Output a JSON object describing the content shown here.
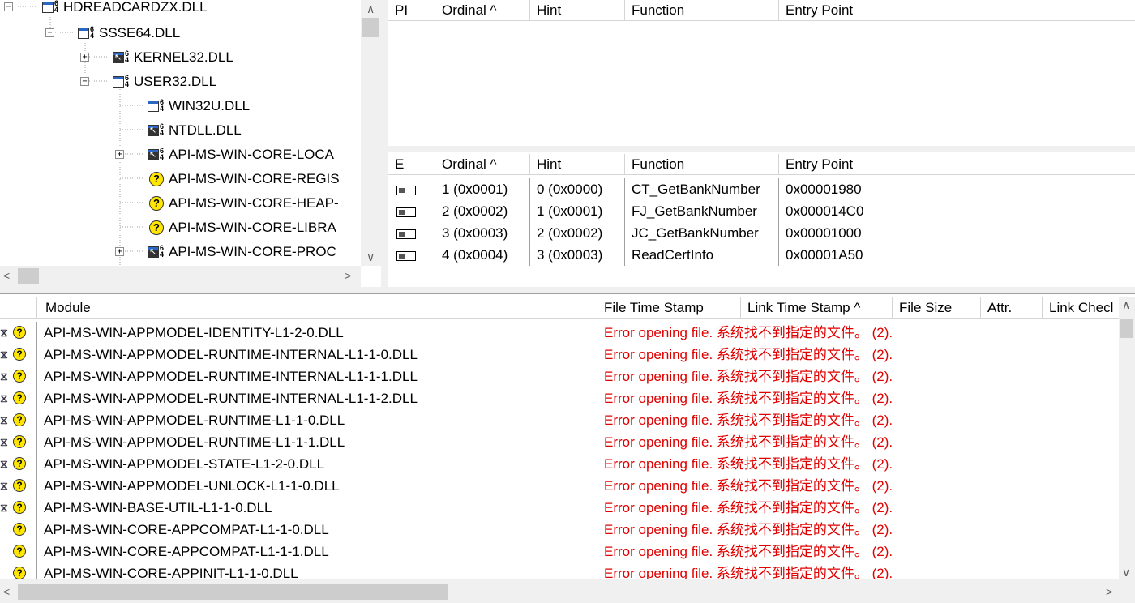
{
  "tree": {
    "nodes": [
      {
        "label": "HDREADCARDZX.DLL",
        "icon": "dll-module-icon"
      },
      {
        "label": "SSSE64.DLL",
        "icon": "dll-module-icon"
      },
      {
        "label": "KERNEL32.DLL",
        "icon": "dll-forwarded-icon"
      },
      {
        "label": "USER32.DLL",
        "icon": "dll-module-icon"
      },
      {
        "label": "WIN32U.DLL",
        "icon": "dll-module-icon"
      },
      {
        "label": "NTDLL.DLL",
        "icon": "dll-forwarded-icon"
      },
      {
        "label": "API-MS-WIN-CORE-LOCA",
        "icon": "dll-forwarded-icon"
      },
      {
        "label": "API-MS-WIN-CORE-REGIS",
        "icon": "missing-module-icon"
      },
      {
        "label": "API-MS-WIN-CORE-HEAP-",
        "icon": "missing-module-icon"
      },
      {
        "label": "API-MS-WIN-CORE-LIBRA",
        "icon": "missing-module-icon"
      },
      {
        "label": "API-MS-WIN-CORE-PROC",
        "icon": "dll-forwarded-icon"
      }
    ]
  },
  "imports": {
    "headers": [
      "PI",
      "Ordinal ^",
      "Hint",
      "Function",
      "Entry Point"
    ]
  },
  "exports": {
    "headers": [
      "E",
      "Ordinal ^",
      "Hint",
      "Function",
      "Entry Point"
    ],
    "rows": [
      {
        "ordinal": "1 (0x0001)",
        "hint": "0 (0x0000)",
        "function": "CT_GetBankNumber",
        "entry": "0x00001980"
      },
      {
        "ordinal": "2 (0x0002)",
        "hint": "1 (0x0001)",
        "function": "FJ_GetBankNumber",
        "entry": "0x000014C0"
      },
      {
        "ordinal": "3 (0x0003)",
        "hint": "2 (0x0002)",
        "function": "JC_GetBankNumber",
        "entry": "0x00001000"
      },
      {
        "ordinal": "4 (0x0004)",
        "hint": "3 (0x0003)",
        "function": "ReadCertInfo",
        "entry": "0x00001A50"
      }
    ]
  },
  "modules": {
    "headers": [
      "Module",
      "File Time Stamp",
      "Link Time Stamp ^",
      "File Size",
      "Attr.",
      "Link Checl"
    ],
    "error_text": "Error opening file. 系统找不到指定的文件。 (2).",
    "rows": [
      {
        "name": "API-MS-WIN-APPMODEL-IDENTITY-L1-2-0.DLL",
        "delay": true
      },
      {
        "name": "API-MS-WIN-APPMODEL-RUNTIME-INTERNAL-L1-1-0.DLL",
        "delay": true
      },
      {
        "name": "API-MS-WIN-APPMODEL-RUNTIME-INTERNAL-L1-1-1.DLL",
        "delay": true
      },
      {
        "name": "API-MS-WIN-APPMODEL-RUNTIME-INTERNAL-L1-1-2.DLL",
        "delay": true
      },
      {
        "name": "API-MS-WIN-APPMODEL-RUNTIME-L1-1-0.DLL",
        "delay": true
      },
      {
        "name": "API-MS-WIN-APPMODEL-RUNTIME-L1-1-1.DLL",
        "delay": true
      },
      {
        "name": "API-MS-WIN-APPMODEL-STATE-L1-2-0.DLL",
        "delay": true
      },
      {
        "name": "API-MS-WIN-APPMODEL-UNLOCK-L1-1-0.DLL",
        "delay": true
      },
      {
        "name": "API-MS-WIN-BASE-UTIL-L1-1-0.DLL",
        "delay": true
      },
      {
        "name": "API-MS-WIN-CORE-APPCOMPAT-L1-1-0.DLL",
        "delay": false
      },
      {
        "name": "API-MS-WIN-CORE-APPCOMPAT-L1-1-1.DLL",
        "delay": false
      },
      {
        "name": "API-MS-WIN-CORE-APPINIT-L1-1-0.DLL",
        "delay": false
      }
    ]
  },
  "icons": {
    "error_color": "#e00000",
    "missing": "?",
    "delay_load": "⧖"
  }
}
